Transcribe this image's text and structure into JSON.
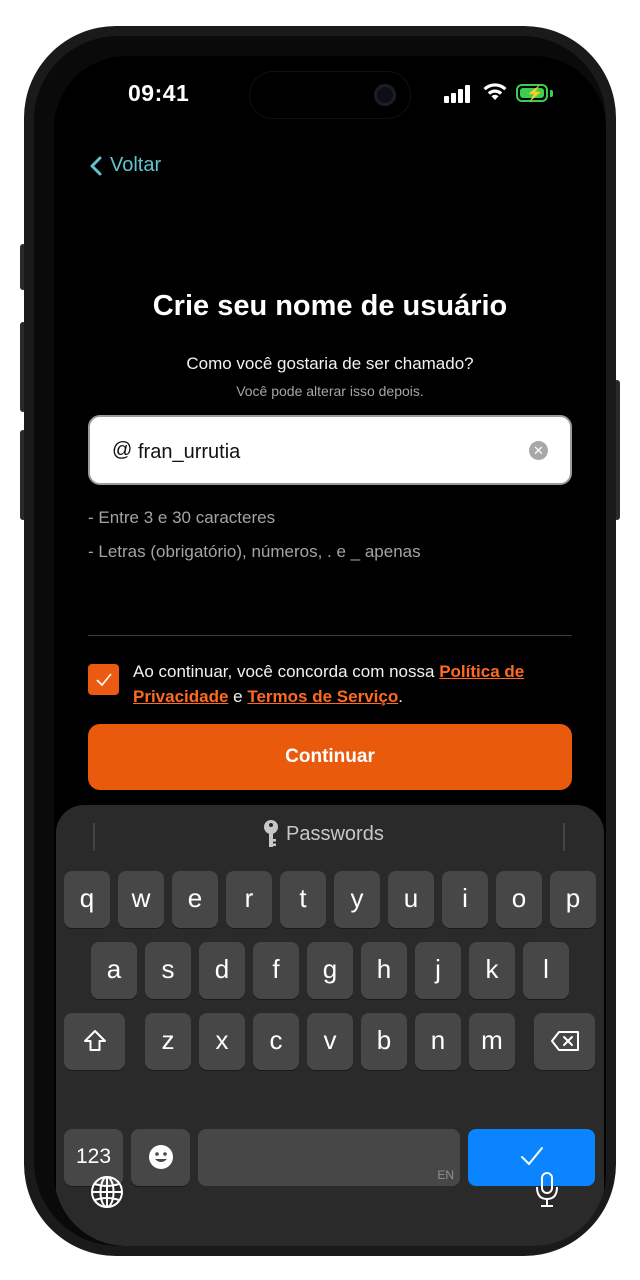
{
  "status_bar": {
    "time": "09:41"
  },
  "nav": {
    "back_label": "Voltar"
  },
  "heading": {
    "title": "Crie seu nome de usuário",
    "subtitle": "Como você gostaria de ser chamado?",
    "hint": "Você pode alterar isso depois."
  },
  "username_input": {
    "prefix": "@",
    "value": "fran_urrutia"
  },
  "rules": [
    "- Entre 3 e 30 caracteres",
    "- Letras (obrigatório), números, . e _ apenas"
  ],
  "consent": {
    "checked": true,
    "text_before": "Ao continuar, você concorda com nossa ",
    "privacy_link": "Política de Privacidade",
    "text_middle": " e ",
    "terms_link": "Termos de Serviço",
    "text_after": "."
  },
  "cta": {
    "label": "Continuar"
  },
  "keyboard": {
    "suggestion_label": "Passwords",
    "row1": [
      "q",
      "w",
      "e",
      "r",
      "t",
      "y",
      "u",
      "i",
      "o",
      "p"
    ],
    "row2": [
      "a",
      "s",
      "d",
      "f",
      "g",
      "h",
      "j",
      "k",
      "l"
    ],
    "row3": [
      "z",
      "x",
      "c",
      "v",
      "b",
      "n",
      "m"
    ],
    "numbers_key": "123",
    "space_language": "EN"
  },
  "colors": {
    "accent": "#ea5a0c",
    "link": "#ff6a1f",
    "back": "#62c3cc",
    "done_key": "#0a84ff",
    "battery": "#3ccf4e"
  }
}
